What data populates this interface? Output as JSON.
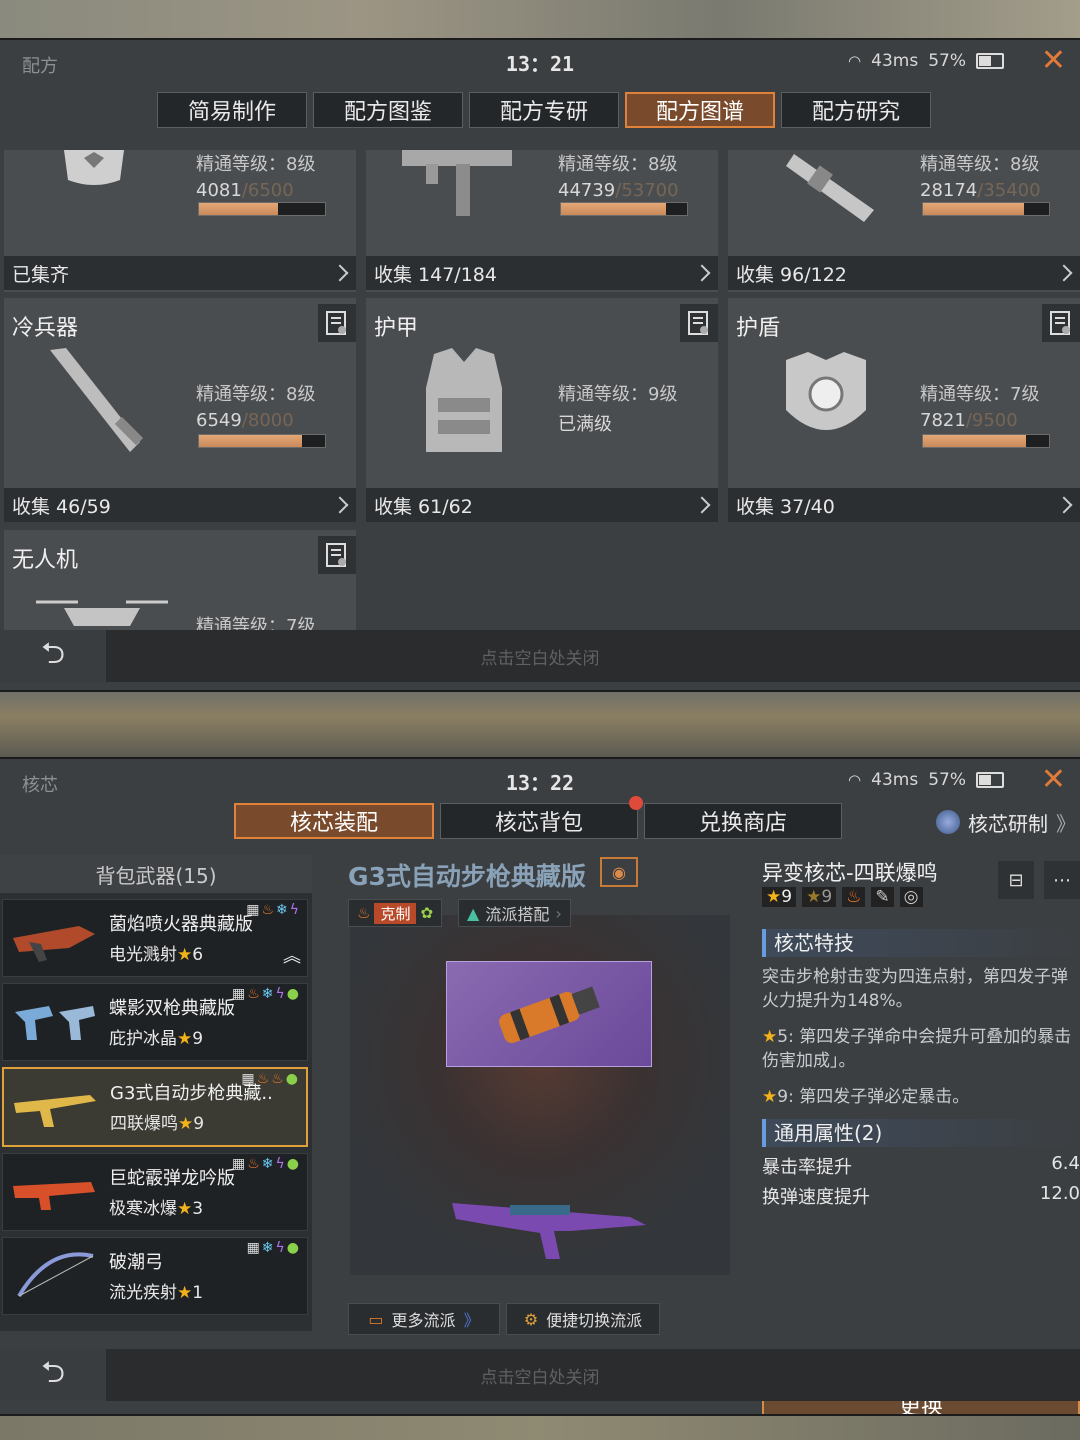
{
  "screen1": {
    "title": "配方",
    "time": "13：21",
    "ping": "43ms",
    "battery": "57%",
    "tabs": [
      "简易制作",
      "配方图鉴",
      "配方专研",
      "配方图谱",
      "配方研究"
    ],
    "active_tab": "配方图谱",
    "cards": [
      {
        "title": "",
        "mastery": "精通等级：8级",
        "progress": "4081",
        "progress_max": "/6500",
        "fill": 0.63,
        "collect": "已集齐",
        "icon": "cap-icon"
      },
      {
        "title": "",
        "mastery": "精通等级：8级",
        "progress": "44739",
        "progress_max": "/53700",
        "fill": 0.83,
        "collect": "收集 147/184",
        "icon": "smg-icon"
      },
      {
        "title": "",
        "mastery": "精通等级：8级",
        "progress": "28174",
        "progress_max": "/35400",
        "fill": 0.8,
        "collect": "收集 96/122",
        "icon": "launcher-icon"
      },
      {
        "title": "冷兵器",
        "mastery": "精通等级：8级",
        "progress": "6549",
        "progress_max": "/8000",
        "fill": 0.82,
        "collect": "收集 46/59",
        "icon": "blade-icon"
      },
      {
        "title": "护甲",
        "mastery": "精通等级：9级",
        "progress": "已满级",
        "progress_max": "",
        "fill": null,
        "collect": "收集 61/62",
        "icon": "vest-icon"
      },
      {
        "title": "护盾",
        "mastery": "精通等级：7级",
        "progress": "7821",
        "progress_max": "/9500",
        "fill": 0.82,
        "collect": "收集 37/40",
        "icon": "shield-icon"
      },
      {
        "title": "无人机",
        "mastery": "精通等级：7级",
        "progress": "",
        "progress_max": "",
        "fill": null,
        "collect": "",
        "icon": "drone-icon"
      }
    ],
    "close_hint": "点击空白处关闭"
  },
  "screen2": {
    "title": "核芯",
    "time": "13：22",
    "ping": "43ms",
    "battery": "57%",
    "tabs": [
      "核芯装配",
      "核芯背包",
      "兑换商店"
    ],
    "active_tab": "核芯装配",
    "research_link": "核芯研制",
    "bag_header": "背包武器(15)",
    "weapons": [
      {
        "name": "菌焰喷火器典藏版",
        "core": "电光溅射",
        "stars": "6"
      },
      {
        "name": "蝶影双枪典藏版",
        "core": "庇护冰晶",
        "stars": "9"
      },
      {
        "name": "G3式自动步枪典藏..",
        "core": "四联爆鸣",
        "stars": "9"
      },
      {
        "name": "巨蛇霰弹龙吟版",
        "core": "极寒冰爆",
        "stars": "3"
      },
      {
        "name": "破潮弓",
        "core": "流光疾射",
        "stars": "1"
      }
    ],
    "selected_weapon": 2,
    "gun_name": "G3式自动步枪典藏版",
    "tag_counter": "克制",
    "tag_school": "流派搭配",
    "more_schools": "更多流派",
    "quick_switch": "便捷切换流派",
    "core_name": "异变核芯-四联爆鸣",
    "core_stars_a": "9",
    "core_stars_b": "9",
    "skill_header": "核芯特技",
    "skill_desc": "突击步枪射击变为四连点射，第四发子弹火力提升为148%。",
    "star5": "5: 第四发子弹命中会提升可叠加的暴击伤害加成」。",
    "star9": "9: 第四发子弹必定暴击。",
    "attr_header": "通用属性(2)",
    "attrs": [
      {
        "name": "暴击率提升",
        "value": "6.4"
      },
      {
        "name": "换弹速度提升",
        "value": "12.0"
      }
    ],
    "replace_button": "更换",
    "close_hint": "点击空白处关闭"
  }
}
